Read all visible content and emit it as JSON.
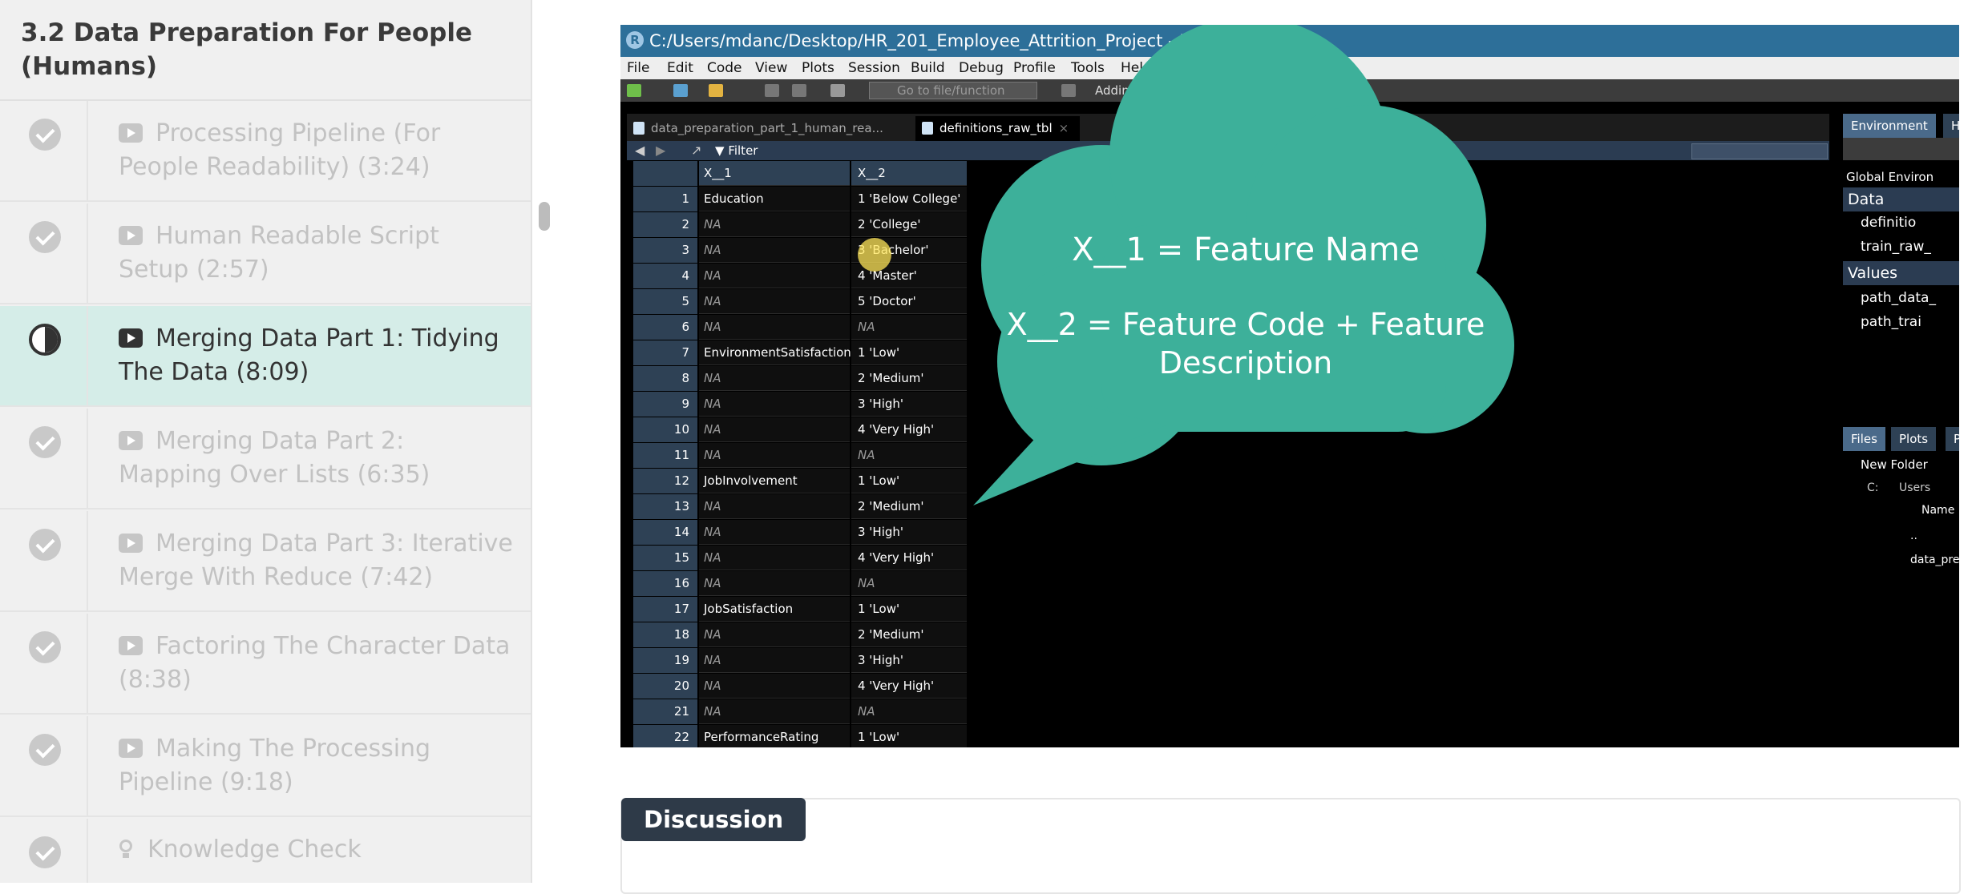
{
  "sidebar": {
    "section_title": "3.2 Data Preparation For People (Humans)",
    "lessons": [
      {
        "label": "Processing Pipeline (For People Readability) (3:24)",
        "status": "complete",
        "icon": "video-icon"
      },
      {
        "label": "Human Readable Script Setup (2:57)",
        "status": "complete",
        "icon": "video-icon"
      },
      {
        "label": "Merging Data Part 1: Tidying The Data (8:09)",
        "status": "in-progress",
        "icon": "video-icon"
      },
      {
        "label": "Merging Data Part 2: Mapping Over Lists (6:35)",
        "status": "complete",
        "icon": "video-icon"
      },
      {
        "label": "Merging Data Part 3: Iterative Merge With Reduce (7:42)",
        "status": "complete",
        "icon": "video-icon"
      },
      {
        "label": "Factoring The Character Data (8:38)",
        "status": "complete",
        "icon": "video-icon"
      },
      {
        "label": "Making The Processing Pipeline (9:18)",
        "status": "complete",
        "icon": "video-icon"
      },
      {
        "label": "Knowledge Check",
        "status": "complete",
        "icon": "lightbulb-icon"
      }
    ]
  },
  "video": {
    "window_title": "C:/Users/mdanc/Desktop/HR_201_Employee_Attrition_Project - RStudio",
    "menu": [
      "File",
      "Edit",
      "Code",
      "View",
      "Plots",
      "Session",
      "Build",
      "Debug",
      "Profile",
      "Tools",
      "Help"
    ],
    "toolbar": {
      "goto_placeholder": "Go to file/function",
      "addins": "Addins"
    },
    "tabs": [
      {
        "label": "data_preparation_part_1_human_rea... *"
      },
      {
        "label": "definitions_raw_tbl"
      }
    ],
    "filter_label": "Filter",
    "grid": {
      "columns": [
        "X__1",
        "X__2"
      ],
      "rows": [
        {
          "n": "1",
          "c1": "Education",
          "c2": "1 'Below College'"
        },
        {
          "n": "2",
          "c1": "NA",
          "c2": "2 'College'"
        },
        {
          "n": "3",
          "c1": "NA",
          "c2": "3 'Bachelor'"
        },
        {
          "n": "4",
          "c1": "NA",
          "c2": "4 'Master'"
        },
        {
          "n": "5",
          "c1": "NA",
          "c2": "5 'Doctor'"
        },
        {
          "n": "6",
          "c1": "NA",
          "c2": "NA"
        },
        {
          "n": "7",
          "c1": "EnvironmentSatisfaction",
          "c2": "1 'Low'"
        },
        {
          "n": "8",
          "c1": "NA",
          "c2": "2 'Medium'"
        },
        {
          "n": "9",
          "c1": "NA",
          "c2": "3 'High'"
        },
        {
          "n": "10",
          "c1": "NA",
          "c2": "4 'Very High'"
        },
        {
          "n": "11",
          "c1": "NA",
          "c2": "NA"
        },
        {
          "n": "12",
          "c1": "JobInvolvement",
          "c2": "1 'Low'"
        },
        {
          "n": "13",
          "c1": "NA",
          "c2": "2 'Medium'"
        },
        {
          "n": "14",
          "c1": "NA",
          "c2": "3 'High'"
        },
        {
          "n": "15",
          "c1": "NA",
          "c2": "4 'Very High'"
        },
        {
          "n": "16",
          "c1": "NA",
          "c2": "NA"
        },
        {
          "n": "17",
          "c1": "JobSatisfaction",
          "c2": "1 'Low'"
        },
        {
          "n": "18",
          "c1": "NA",
          "c2": "2 'Medium'"
        },
        {
          "n": "19",
          "c1": "NA",
          "c2": "3 'High'"
        },
        {
          "n": "20",
          "c1": "NA",
          "c2": "4 'Very High'"
        },
        {
          "n": "21",
          "c1": "NA",
          "c2": "NA"
        },
        {
          "n": "22",
          "c1": "PerformanceRating",
          "c2": "1 'Low'"
        }
      ]
    },
    "env_pane": {
      "tabs": [
        "Environment",
        "Hi"
      ],
      "global_env": "Global Environ",
      "data_header": "Data",
      "data_items": [
        "definitio",
        "train_raw_"
      ],
      "values_header": "Values",
      "value_items": [
        "path_data_",
        "path_trai"
      ]
    },
    "files_pane": {
      "tabs": [
        "Files",
        "Plots",
        "Pa"
      ],
      "new_folder": "New Folder",
      "path": [
        "C:",
        "Users"
      ],
      "name_col": "Name",
      "items": [
        "..",
        "data_pre"
      ]
    },
    "callout": {
      "line1": "X__1 = Feature Name",
      "line2": "X__2 = Feature Code + Feature Description",
      "color": "#3db09a"
    }
  },
  "discussion": {
    "label": "Discussion"
  }
}
